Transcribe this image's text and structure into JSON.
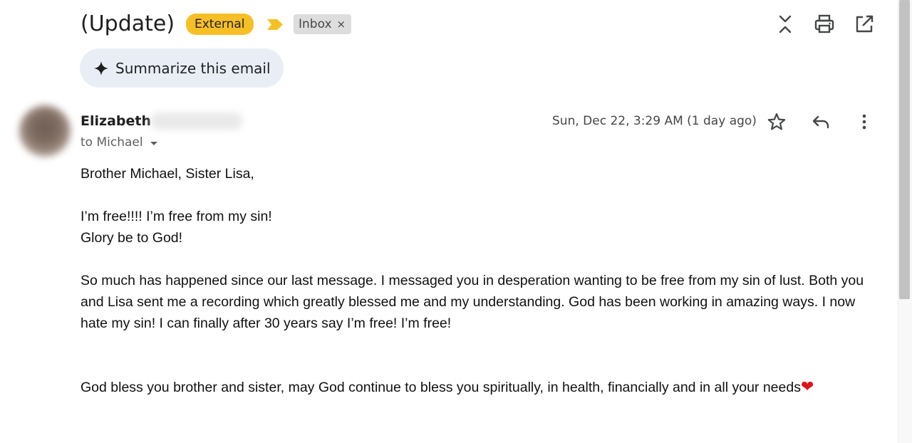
{
  "header": {
    "subject": "(Update)",
    "external_label": "External",
    "inbox_label": "Inbox",
    "inbox_remove": "×"
  },
  "toolbar": {
    "icons": [
      "collapse-all-icon",
      "print-icon",
      "open-in-new-window-icon"
    ]
  },
  "summarize": {
    "label": "Summarize this email"
  },
  "message": {
    "sender_name": "Elizabeth",
    "recipient": "to Michael",
    "timestamp": "Sun, Dec 22, 3:29 AM (1 day ago)",
    "actions": [
      "star-icon",
      "reply-icon",
      "more-vert-icon"
    ],
    "body": {
      "greeting": "Brother Michael, Sister Lisa,",
      "line1": "I’m free!!!! I’m free from my sin!",
      "line2": "Glory be to God!",
      "paragraph": "So much has happened since our last message. I messaged you in desperation wanting to be free from my sin of lust. Both you and Lisa sent me a recording which greatly blessed me and my understanding. God has been working in amazing ways. I now hate my sin! I can finally after 30 years say I’m free! I’m free!",
      "closing": "God bless you brother and sister, may God continue to bless you spiritually, in health, financially and in all your needs",
      "closing_emoji": "❤"
    }
  },
  "colors": {
    "external_tag": "#f6bf26",
    "important_marker": "#f6c026",
    "inbox_tag": "#dddddd",
    "summarize_bg": "#e9eef6",
    "heart": "#e0141e"
  }
}
